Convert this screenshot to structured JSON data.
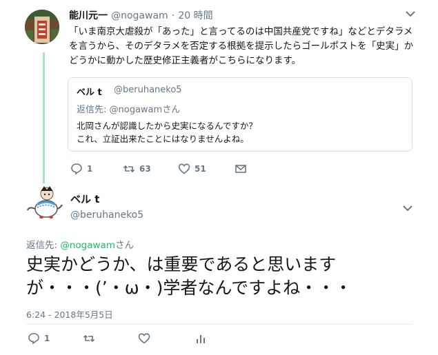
{
  "parent_tweet": {
    "name": "能川元一",
    "handle": "@nogawam",
    "separator": "·",
    "time": "20 時間",
    "text": "「いま南京大虐殺が「あった」と言ってるのは中国共産党ですね」などとデタラメを言うから、そのデタラメを否定する根拠を提示したらゴールポストを「史実」かどうかに動かした歴史修正主義者がこちらになります。",
    "quote": {
      "name": "ベル t",
      "handle": "@beruhaneko5",
      "reply_label": "返信先: ",
      "reply_to": "@nogawamさん",
      "text_line1": "北岡さんが認識したから史実になるんですか？",
      "text_line2": "これ、立証出来たことにはなりませんよね。"
    },
    "actions": {
      "replies": "1",
      "retweets": "63",
      "likes": "51"
    }
  },
  "main_tweet": {
    "name": "ベル t",
    "handle": "@beruhaneko5",
    "reply_label": "返信先: ",
    "reply_mention": "@nogawam",
    "reply_suffix": "さん",
    "text_line1": "史実かどうか、は重要であると思います",
    "text_line2": "が・・・(ʼ・ω・)学者なんですよね・・・",
    "timestamp": "6:24 - 2018年5月5日",
    "actions": {
      "replies": "1"
    }
  },
  "colors": {
    "thread_line": "#a8e6bf",
    "mention": "#17bf63",
    "secondary": "#657786"
  }
}
